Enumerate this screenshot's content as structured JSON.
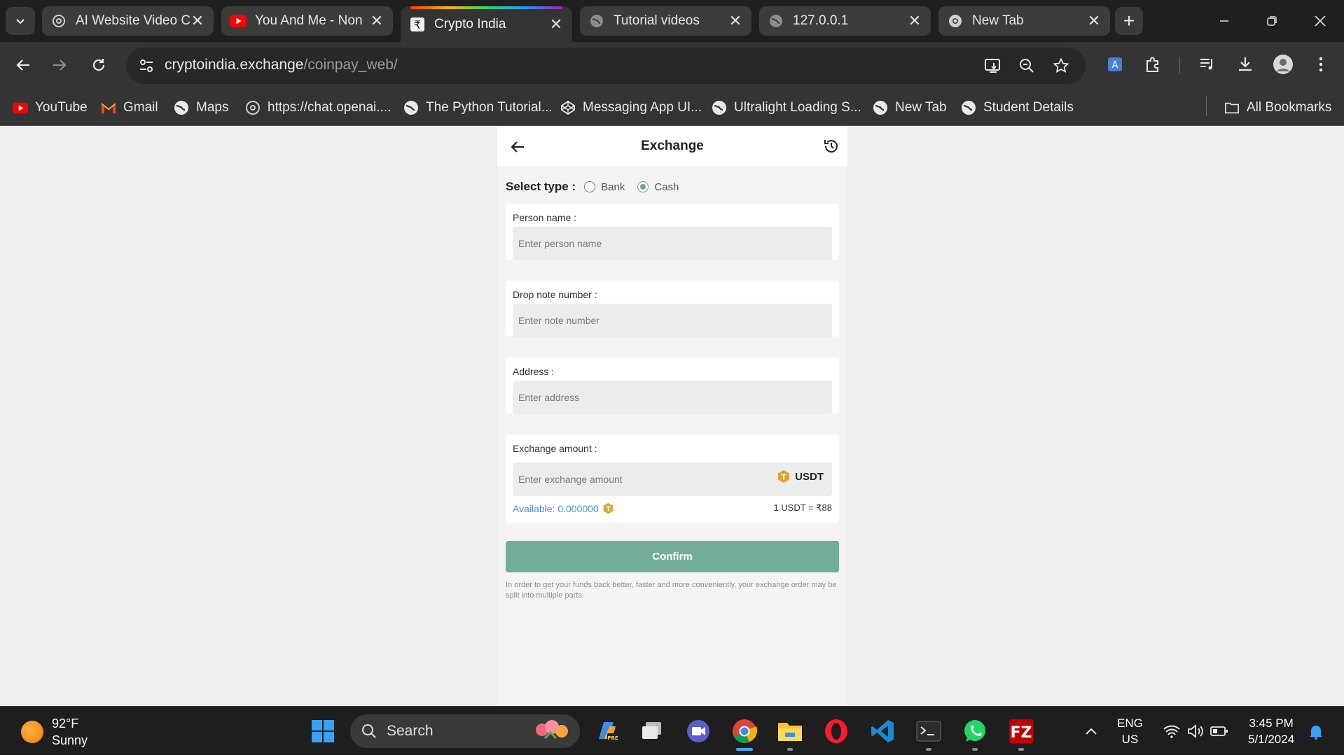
{
  "browser": {
    "tabs": [
      {
        "title": "AI Website Video C",
        "favicon": "openai-icon"
      },
      {
        "title": "You And Me - Non",
        "favicon": "youtube-icon"
      },
      {
        "title": "Crypto India",
        "favicon": "rupee-icon",
        "active": true
      },
      {
        "title": "Tutorial videos",
        "favicon": "globe-icon"
      },
      {
        "title": "127.0.0.1",
        "favicon": "globe-icon"
      },
      {
        "title": "New Tab",
        "favicon": "chrome-icon"
      }
    ],
    "address": {
      "domain": "cryptoindia.exchange",
      "path": "/coinpay_web/"
    },
    "bookmarks": [
      {
        "label": "YouTube",
        "icon": "youtube-icon"
      },
      {
        "label": "Gmail",
        "icon": "gmail-icon"
      },
      {
        "label": "Maps",
        "icon": "globe-icon"
      },
      {
        "label": "https://chat.openai....",
        "icon": "openai-icon"
      },
      {
        "label": "The Python Tutorial...",
        "icon": "globe-icon"
      },
      {
        "label": "Messaging App UI...",
        "icon": "codepen-icon"
      },
      {
        "label": "Ultralight Loading S...",
        "icon": "globe-icon"
      },
      {
        "label": "New Tab",
        "icon": "globe-icon"
      },
      {
        "label": "Student Details",
        "icon": "globe-icon"
      }
    ],
    "all_bookmarks": "All Bookmarks"
  },
  "app": {
    "header_title": "Exchange",
    "select_type_label": "Select type :",
    "types": [
      {
        "label": "Bank",
        "checked": false
      },
      {
        "label": "Cash",
        "checked": true
      }
    ],
    "fields": {
      "person_name": {
        "label": "Person name :",
        "placeholder": "Enter person name",
        "value": ""
      },
      "note_number": {
        "label": "Drop note number :",
        "placeholder": "Enter note number",
        "value": ""
      },
      "address": {
        "label": "Address :",
        "placeholder": "Enter address",
        "value": ""
      },
      "exchange_amount": {
        "label": "Exchange amount :",
        "placeholder": "Enter exchange amount",
        "value": "",
        "currency": "USDT"
      }
    },
    "available": "Available: 0.000000",
    "rate": "1 USDT = ₹88",
    "confirm_label": "Confirm",
    "notice": "In order to get your funds back better, faster and more conveniently, your exchange order may be split into multiple parts",
    "colors": {
      "accent": "#74ad97",
      "link": "#4a8fd4",
      "coin": "#e1a52a"
    }
  },
  "taskbar": {
    "weather": {
      "temp": "92°F",
      "condition": "Sunny"
    },
    "search_placeholder": "Search",
    "language": {
      "line1": "ENG",
      "line2": "US"
    },
    "clock": {
      "time": "3:45 PM",
      "date": "5/1/2024"
    }
  }
}
